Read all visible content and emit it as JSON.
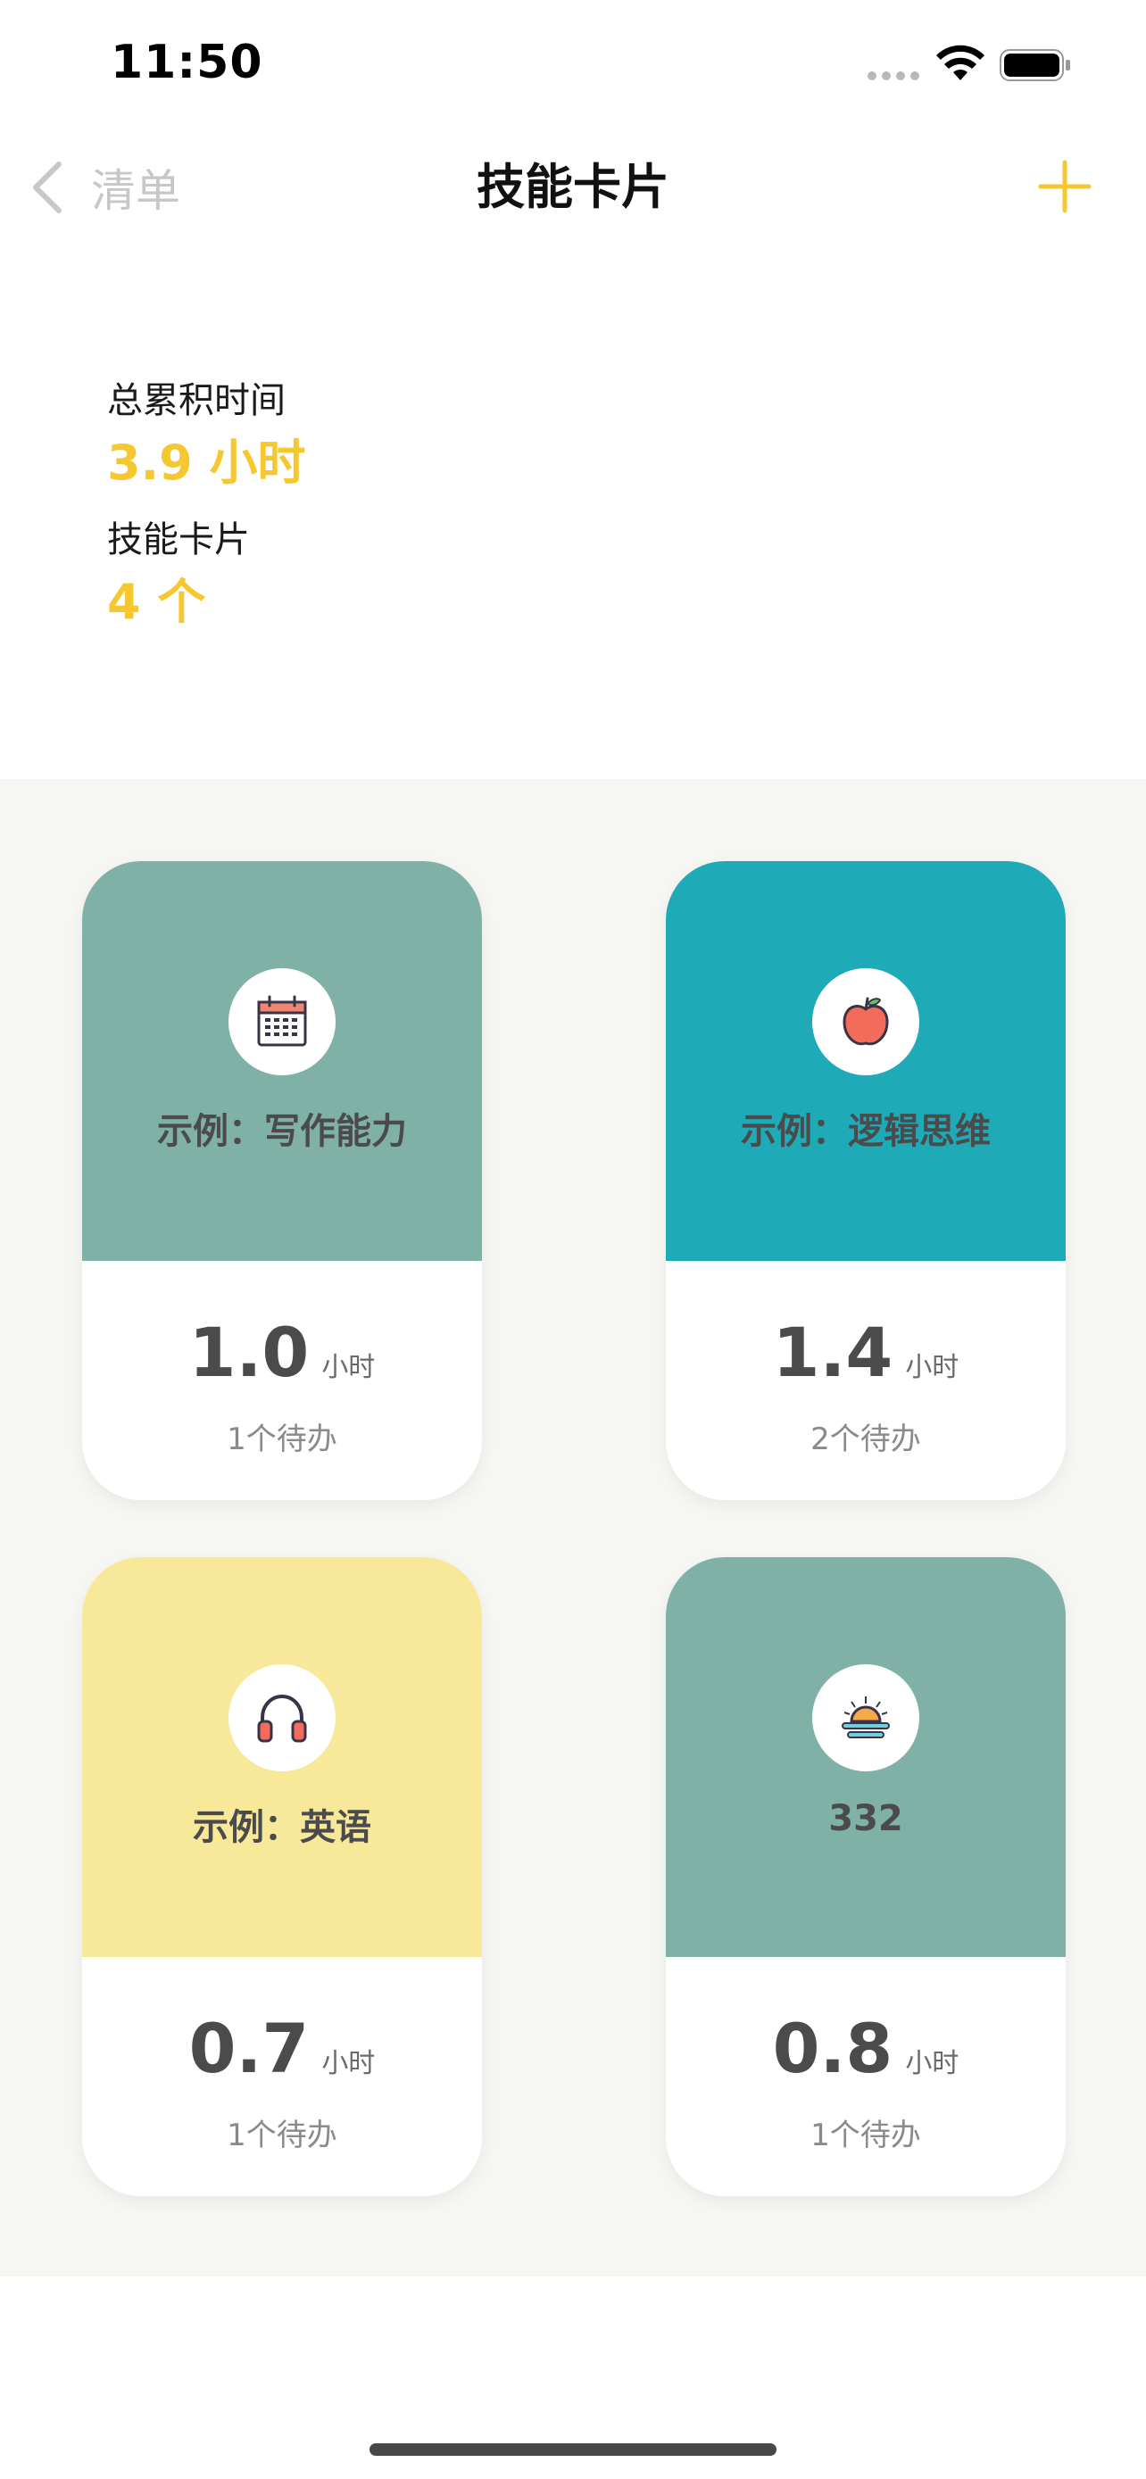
{
  "status_bar": {
    "time": "11:50"
  },
  "nav": {
    "back_label": "清单",
    "title": "技能卡片",
    "accent_color": "#F7C72F"
  },
  "summary": {
    "total_time_label": "总累积时间",
    "total_time_value": "3.9 小时",
    "cards_label": "技能卡片",
    "cards_value": "4 个"
  },
  "cards": [
    {
      "name": "示例：写作能力",
      "icon": "calendar-icon",
      "color": "#7FB1A6",
      "hours": "1.0",
      "unit": "小时",
      "todo": "1个待办"
    },
    {
      "name": "示例：逻辑思维",
      "icon": "apple-icon",
      "color": "#1FAAB8",
      "hours": "1.4",
      "unit": "小时",
      "todo": "2个待办"
    },
    {
      "name": "示例：英语",
      "icon": "headphones-icon",
      "color": "#F7E89A",
      "hours": "0.7",
      "unit": "小时",
      "todo": "1个待办"
    },
    {
      "name": "332",
      "icon": "sunset-icon",
      "color": "#7FB1A6",
      "hours": "0.8",
      "unit": "小时",
      "todo": "1个待办"
    }
  ]
}
